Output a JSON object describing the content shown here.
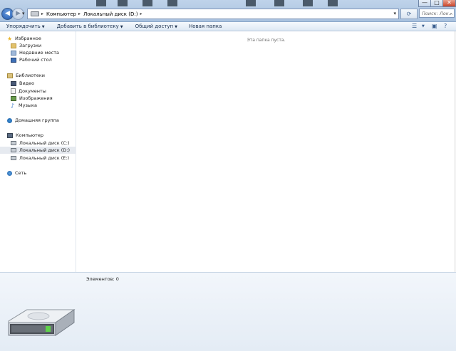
{
  "window": {
    "minimize_glyph": "—",
    "maximize_glyph": "□",
    "close_glyph": "✕"
  },
  "address": {
    "breadcrumbs": [
      "Компьютер",
      "Локальный диск (D:)"
    ],
    "separator": "▸"
  },
  "search": {
    "placeholder": "Поиск: Лок..."
  },
  "toolbar": {
    "organize": "Упорядочить",
    "add_to_library": "Добавить в библиотеку",
    "share": "Общий доступ",
    "new_folder": "Новая папка",
    "dropdown_arrow": "▼"
  },
  "nav": {
    "favorites": {
      "label": "Избранное",
      "items": [
        "Загрузки",
        "Недавние места",
        "Рабочий стол"
      ]
    },
    "libraries": {
      "label": "Библиотеки",
      "items": [
        "Видео",
        "Документы",
        "Изображения",
        "Музыка"
      ]
    },
    "homegroup": {
      "label": "Домашняя группа"
    },
    "computer": {
      "label": "Компьютер",
      "items": [
        "Локальный диск (C:)",
        "Локальный диск (D:)",
        "Локальный диск (E:)"
      ],
      "selected": "Локальный диск (D:)"
    },
    "network": {
      "label": "Сеть"
    }
  },
  "content": {
    "empty_message": "Эта папка пуста."
  },
  "details": {
    "item_count": "Элементов: 0"
  },
  "colors": {
    "accent": "#1f58b0",
    "selection": "#e6eaf0",
    "toolbar_text": "#1a2f4d",
    "drive_led": "#5fd34a"
  },
  "icons": {
    "favorites": "star-icon",
    "downloads": "download-folder-icon",
    "recent": "recent-places-icon",
    "desktop": "desktop-icon",
    "libraries": "libraries-icon",
    "video": "video-library-icon",
    "documents": "documents-library-icon",
    "pictures": "pictures-library-icon",
    "music": "music-library-icon",
    "homegroup": "homegroup-icon",
    "computer": "computer-icon",
    "drive": "hard-drive-icon",
    "network": "network-icon"
  }
}
